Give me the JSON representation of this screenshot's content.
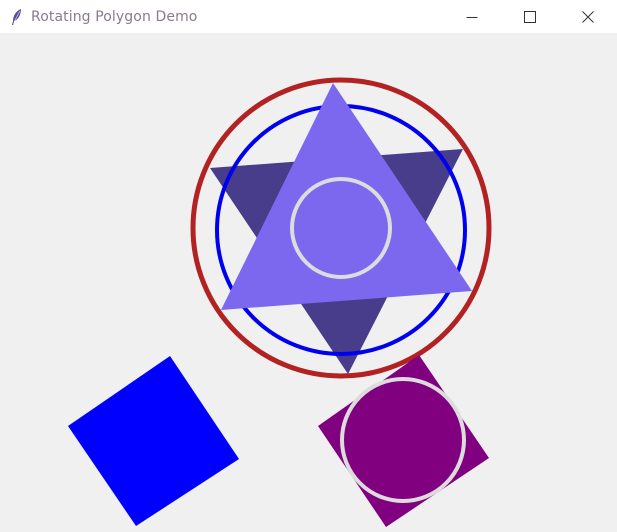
{
  "window": {
    "title": "Rotating Polygon Demo",
    "app_icon": "feather-icon"
  },
  "controls": {
    "minimize_icon": "minimize-icon",
    "maximize_icon": "maximize-icon",
    "close_icon": "close-icon"
  },
  "colors": {
    "titlebar_bg": "#ffffff",
    "canvas_bg": "#f0f0f0",
    "outer_circle": "#b22222",
    "inner_circle": "#0000ee",
    "rear_triangle": "#483d8b",
    "front_triangle": "#7b68ee",
    "center_circle_fill": "#7b68ee",
    "light_ring": "#dcdcdc",
    "blue_square": "#0000ff",
    "purple_square": "#800080",
    "purple_circle": "#800080"
  }
}
